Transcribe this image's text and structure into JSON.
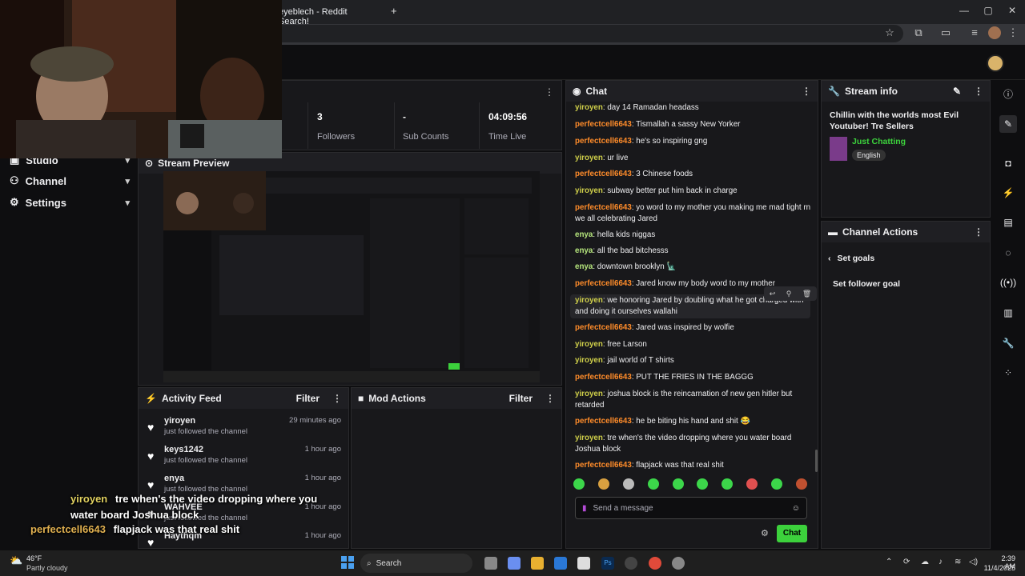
{
  "browser": {
    "tab_title": "eyeblech - Reddit Search!",
    "new_tab": "+",
    "close_tab": "✕",
    "min": "—",
    "max": "▢",
    "close": "✕"
  },
  "nav": {
    "items": [
      {
        "label": "Studio"
      },
      {
        "label": "Channel"
      },
      {
        "label": "Settings"
      }
    ]
  },
  "stats": [
    {
      "value": "3",
      "label": "Followers"
    },
    {
      "value": "-",
      "label": "Sub Counts"
    },
    {
      "value": "04:09:56",
      "label": "Time Live"
    }
  ],
  "preview": {
    "title": "Stream Preview"
  },
  "activity": {
    "title": "Activity Feed",
    "filter": "Filter",
    "items": [
      {
        "user": "yiroyen",
        "sub": "just followed the channel",
        "time": "29 minutes ago"
      },
      {
        "user": "keys1242",
        "sub": "just followed the channel",
        "time": "1 hour ago"
      },
      {
        "user": "enya",
        "sub": "just followed the channel",
        "time": "1 hour ago"
      },
      {
        "user": "WAHVEE",
        "sub": "just followed the channel",
        "time": "1 hour ago"
      },
      {
        "user": "Haythqm",
        "sub": "just followed the channel",
        "time": "1 hour ago"
      }
    ]
  },
  "mod": {
    "title": "Mod Actions",
    "filter": "Filter"
  },
  "overlay": [
    {
      "name": "yiroyen",
      "text": "tre when's the video dropping where you water board Joshua block"
    },
    {
      "name": "perfectcell6643",
      "text": "flapjack was that real shit"
    }
  ],
  "chat": {
    "title": "Chat",
    "placeholder": "Send a message",
    "button": "Chat",
    "messages": [
      {
        "name": "yiroyen",
        "c": "y",
        "text": "day 14 Ramadan headass"
      },
      {
        "name": "perfectcell6643",
        "c": "p",
        "text": "Tismallah a sassy New Yorker"
      },
      {
        "name": "perfectcell6643",
        "c": "p",
        "text": "he's so inspiring gng"
      },
      {
        "name": "yiroyen",
        "c": "y",
        "text": "ur live"
      },
      {
        "name": "perfectcell6643",
        "c": "p",
        "text": "3 Chinese foods"
      },
      {
        "name": "yiroyen",
        "c": "y",
        "text": "subway better put him back in charge"
      },
      {
        "name": "perfectcell6643",
        "c": "p",
        "text": "yo word to my mother you making me mad tight rn we all celebrating Jared"
      },
      {
        "name": "enya",
        "c": "e",
        "text": "hella kids niggas"
      },
      {
        "name": "enya",
        "c": "e",
        "text": "all the bad bitchesss"
      },
      {
        "name": "enya",
        "c": "e",
        "text": "downtown brooklyn 🗽"
      },
      {
        "name": "perfectcell6643",
        "c": "p",
        "text": "Jared know my body word to my mother"
      },
      {
        "name": "yiroyen",
        "c": "y",
        "text": "we honoring Jared by doubling what he got charged with and doing it ourselves wallahi"
      },
      {
        "name": "perfectcell6643",
        "c": "p",
        "text": "Jared was inspired by wolfie"
      },
      {
        "name": "yiroyen",
        "c": "y",
        "text": "free Larson"
      },
      {
        "name": "yiroyen",
        "c": "y",
        "text": "jail world of T shirts"
      },
      {
        "name": "perfectcell6643",
        "c": "p",
        "text": "PUT THE FRIES IN THE BAGGG"
      },
      {
        "name": "yiroyen",
        "c": "y",
        "text": "joshua block is the reincarnation of new gen hitler but retarded"
      },
      {
        "name": "perfectcell6643",
        "c": "p",
        "text": "he be biting his hand and shit 😂"
      },
      {
        "name": "yiroyen",
        "c": "y",
        "text": "tre when's the video dropping where you water board Joshua block"
      },
      {
        "name": "perfectcell6643",
        "c": "p",
        "text": "flapjack was that real shit"
      }
    ]
  },
  "stream_info": {
    "title": "Stream info",
    "stream_title": "Chillin with the worlds most Evil Youtuber! Tre Sellers",
    "category": "Just Chatting",
    "tag": "English"
  },
  "channel_actions": {
    "title": "Channel Actions",
    "back": "Set goals",
    "item": "Set follower goal"
  },
  "taskbar": {
    "weather_temp": "46°F",
    "weather_desc": "Partly cloudy",
    "search": "Search",
    "time": "2:39 AM",
    "date": "11/4/2025"
  },
  "colors": {
    "accent": "#3cd13c",
    "orange_user": "#ff8c2a",
    "yellow_user": "#d0d04a",
    "green_user": "#b7e77d"
  }
}
